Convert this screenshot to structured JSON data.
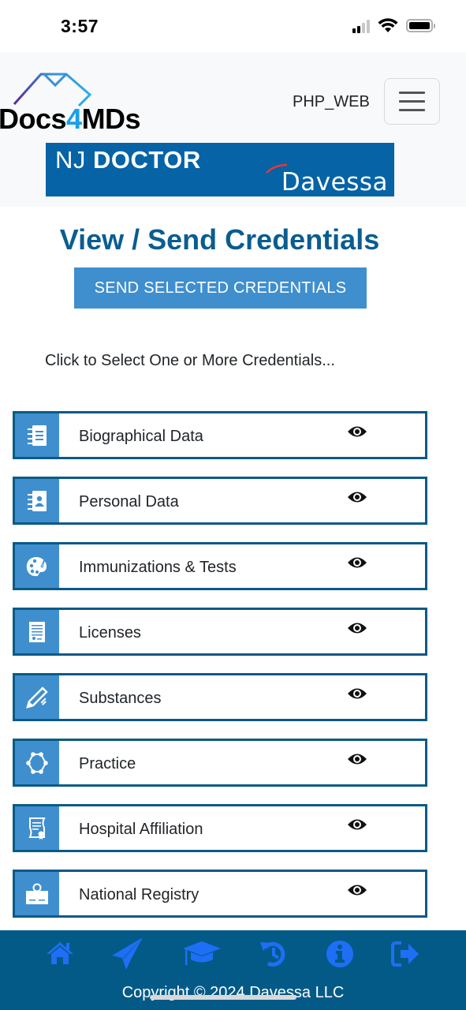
{
  "status_bar": {
    "time": "3:57",
    "signal_bars_active": 2,
    "signal_bars_total": 4,
    "battery_level_percent": 100
  },
  "header": {
    "logo": {
      "text_before": "Docs",
      "text_highlight": "4",
      "text_after": "MDs",
      "highlight_color": "#1aa0e6"
    },
    "user_label": "PHP_WEB",
    "menu_icon": "hamburger-icon",
    "banner": {
      "prefix": "NJ ",
      "bold": "DOCTOR",
      "brand": "Davessa",
      "background": "#0563a6"
    }
  },
  "page": {
    "title": "View / Send Credentials",
    "send_button_label": "SEND SELECTED CREDENTIALS",
    "hint": "Click to Select One or More Credentials..."
  },
  "credentials": [
    {
      "label": "Biographical Data",
      "icon": "address-book-icon",
      "action_icon": "eye-icon"
    },
    {
      "label": "Personal Data",
      "icon": "contact-card-icon",
      "action_icon": "eye-icon"
    },
    {
      "label": "Immunizations & Tests",
      "icon": "palette-icon",
      "action_icon": "eye-icon"
    },
    {
      "label": "Licenses",
      "icon": "license-document-icon",
      "action_icon": "eye-icon"
    },
    {
      "label": "Substances",
      "icon": "pencil-icon",
      "action_icon": "eye-icon"
    },
    {
      "label": "Practice",
      "icon": "hexagon-nodes-icon",
      "action_icon": "eye-icon"
    },
    {
      "label": "Hospital Affiliation",
      "icon": "scroll-certificate-icon",
      "action_icon": "eye-icon"
    },
    {
      "label": "National Registry",
      "icon": "award-certificate-icon",
      "action_icon": "eye-icon"
    }
  ],
  "footer": {
    "nav_icons": [
      "home-icon",
      "paper-plane-icon",
      "graduation-cap-icon",
      "history-icon",
      "info-icon",
      "sign-out-icon"
    ],
    "icon_color": "#1e6ff5",
    "copyright": "Copyright © 2024 Davessa LLC"
  },
  "colors": {
    "primary_dark": "#0a5d8f",
    "primary_button": "#3f8fcf",
    "footer_bg": "#045a87"
  }
}
